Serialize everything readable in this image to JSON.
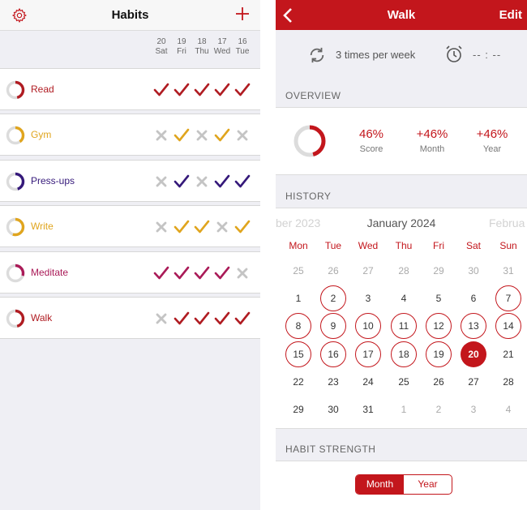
{
  "left": {
    "title": "Habits",
    "icons": {
      "settings": "gear-icon",
      "add": "plus-icon"
    },
    "days": [
      {
        "num": "20",
        "day": "Sat"
      },
      {
        "num": "19",
        "day": "Fri"
      },
      {
        "num": "18",
        "day": "Thu"
      },
      {
        "num": "17",
        "day": "Wed"
      },
      {
        "num": "16",
        "day": "Tue"
      }
    ],
    "habits": [
      {
        "name": "Read",
        "color": "#b01c22",
        "score": 0.46,
        "marks": [
          "check",
          "check",
          "check",
          "check",
          "check"
        ]
      },
      {
        "name": "Gym",
        "color": "#e0a51e",
        "score": 0.4,
        "marks": [
          "cross",
          "check",
          "cross",
          "check",
          "cross"
        ]
      },
      {
        "name": "Press-ups",
        "color": "#35197a",
        "score": 0.45,
        "marks": [
          "cross",
          "check",
          "cross",
          "check",
          "check"
        ]
      },
      {
        "name": "Write",
        "color": "#e0a51e",
        "score": 0.55,
        "marks": [
          "cross",
          "check",
          "check",
          "cross",
          "check"
        ]
      },
      {
        "name": "Meditate",
        "color": "#aa1b58",
        "score": 0.3,
        "marks": [
          "check",
          "check",
          "check",
          "check",
          "cross"
        ]
      },
      {
        "name": "Walk",
        "color": "#b01c22",
        "score": 0.46,
        "marks": [
          "cross",
          "check",
          "check",
          "check",
          "check"
        ]
      }
    ]
  },
  "right": {
    "header": {
      "title": "Walk",
      "edit": "Edit"
    },
    "frequency": "3 times per week",
    "reminder": "-- : --",
    "overview": {
      "label": "OVERVIEW",
      "score": 0.46,
      "stats": [
        {
          "value": "46%",
          "label": "Score"
        },
        {
          "value": "+46%",
          "label": "Month"
        },
        {
          "value": "+46%",
          "label": "Year"
        }
      ]
    },
    "history": {
      "label": "HISTORY",
      "prev_month": "ber 2023",
      "month": "January 2024",
      "next_month": "Februa",
      "weekdays": [
        "Mon",
        "Tue",
        "Wed",
        "Thu",
        "Fri",
        "Sat",
        "Sun"
      ],
      "weeks": [
        [
          {
            "d": "25",
            "s": "dim"
          },
          {
            "d": "26",
            "s": "dim"
          },
          {
            "d": "27",
            "s": "dim"
          },
          {
            "d": "28",
            "s": "dim"
          },
          {
            "d": "29",
            "s": "dim"
          },
          {
            "d": "30",
            "s": "dim"
          },
          {
            "d": "31",
            "s": "dim"
          }
        ],
        [
          {
            "d": "1",
            "s": ""
          },
          {
            "d": "2",
            "s": "hit"
          },
          {
            "d": "3",
            "s": ""
          },
          {
            "d": "4",
            "s": ""
          },
          {
            "d": "5",
            "s": ""
          },
          {
            "d": "6",
            "s": ""
          },
          {
            "d": "7",
            "s": "hit"
          }
        ],
        [
          {
            "d": "8",
            "s": "hit"
          },
          {
            "d": "9",
            "s": "hit"
          },
          {
            "d": "10",
            "s": "hit"
          },
          {
            "d": "11",
            "s": "hit"
          },
          {
            "d": "12",
            "s": "hit"
          },
          {
            "d": "13",
            "s": "hit"
          },
          {
            "d": "14",
            "s": "hit"
          }
        ],
        [
          {
            "d": "15",
            "s": "hit"
          },
          {
            "d": "16",
            "s": "hit"
          },
          {
            "d": "17",
            "s": "hit"
          },
          {
            "d": "18",
            "s": "hit"
          },
          {
            "d": "19",
            "s": "hit"
          },
          {
            "d": "20",
            "s": "today"
          },
          {
            "d": "21",
            "s": ""
          }
        ],
        [
          {
            "d": "22",
            "s": ""
          },
          {
            "d": "23",
            "s": ""
          },
          {
            "d": "24",
            "s": ""
          },
          {
            "d": "25",
            "s": ""
          },
          {
            "d": "26",
            "s": ""
          },
          {
            "d": "27",
            "s": ""
          },
          {
            "d": "28",
            "s": ""
          }
        ],
        [
          {
            "d": "29",
            "s": ""
          },
          {
            "d": "30",
            "s": ""
          },
          {
            "d": "31",
            "s": ""
          },
          {
            "d": "1",
            "s": "dim"
          },
          {
            "d": "2",
            "s": "dim"
          },
          {
            "d": "3",
            "s": "dim"
          },
          {
            "d": "4",
            "s": "dim"
          }
        ]
      ]
    },
    "strength": {
      "label": "HABIT STRENGTH",
      "options": [
        {
          "label": "Month",
          "selected": true
        },
        {
          "label": "Year",
          "selected": false
        }
      ]
    },
    "colors": {
      "accent": "#c3161c",
      "check_gray": "#c4c4c4"
    }
  }
}
